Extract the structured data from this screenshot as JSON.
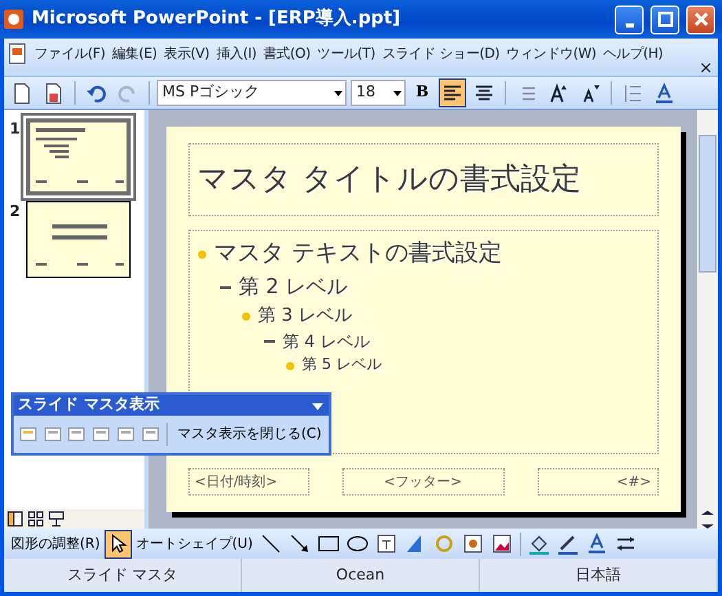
{
  "window": {
    "title": "Microsoft PowerPoint - [ERP導入.ppt]"
  },
  "menu": [
    "ファイル(F)",
    "編集(E)",
    "表示(V)",
    "挿入(I)",
    "書式(O)",
    "ツール(T)",
    "スライド ショー(D)",
    "ウィンドウ(W)",
    "ヘルプ(H)"
  ],
  "menu_close": "×",
  "formatting": {
    "font": "MS Pゴシック",
    "size": "18",
    "bold": "B",
    "align_left_selected": true,
    "align_center_selected": false
  },
  "thumbnails": [
    {
      "number": "1",
      "selected": true
    },
    {
      "number": "2",
      "selected": false,
      "kind": "title"
    }
  ],
  "slide": {
    "title": "マスタ タイトルの書式設定",
    "body": [
      {
        "text": "マスタ テキストの書式設定",
        "children": [
          {
            "text": "第 2 レベル",
            "children": [
              {
                "text": "第 3 レベル",
                "children": [
                  {
                    "text": "第 4 レベル",
                    "children": [
                      {
                        "text": "第 5 レベル"
                      }
                    ]
                  }
                ]
              }
            ]
          }
        ]
      }
    ],
    "footers": [
      "<日付/時刻>",
      "<フッター>",
      "<#>"
    ]
  },
  "master_toolbar": {
    "title": "スライド マスタ表示",
    "close_button": "マスタ表示を閉じる(C)"
  },
  "drawing_toolbar": {
    "arrange": "図形の調整(R)",
    "select_selected": true,
    "autoshapes": "オートシェイプ(U)"
  },
  "status_bar": [
    "スライド マスタ",
    "Ocean",
    "日本語"
  ]
}
